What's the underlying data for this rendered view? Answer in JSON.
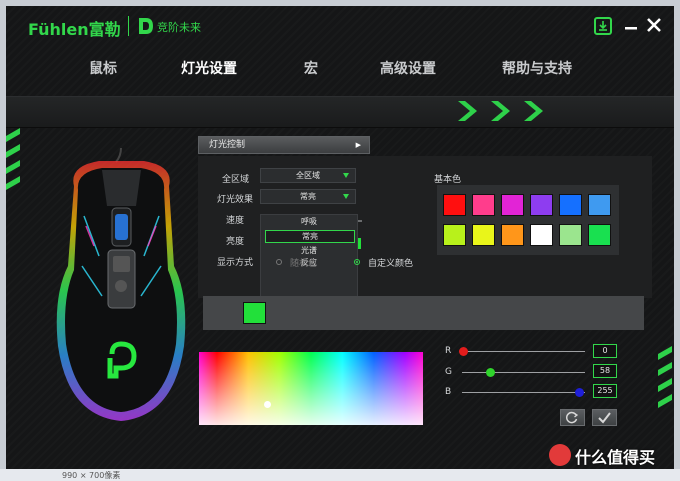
{
  "app": {
    "brand": "Fühlen富勒",
    "slogan": "竞阶未来"
  },
  "window_buttons": {
    "home_icon": "download-home-icon",
    "minimize_icon": "minimize-icon",
    "close_icon": "close-icon"
  },
  "nav": {
    "items": [
      {
        "label": "鼠标"
      },
      {
        "label": "灯光设置",
        "active": true
      },
      {
        "label": "宏"
      },
      {
        "label": "高级设置"
      },
      {
        "label": "帮助与支持"
      }
    ]
  },
  "lighting": {
    "section_title": "灯光控制",
    "zone_label": "全区域",
    "zone_value": "全区域",
    "effect_label": "灯光效果",
    "effect_value": "常亮",
    "speed_label": "速度",
    "brightness_label": "亮度",
    "display_label": "显示方式",
    "speed_level": 0.6,
    "effect_options": [
      "呼吸",
      "常亮",
      "光谱",
      "反应"
    ],
    "effect_selected": "常亮",
    "display_options": [
      "随机色",
      "自定义颜色"
    ],
    "display_selected": "自定义颜色"
  },
  "basic_colors": {
    "title": "基本色",
    "swatches": [
      "#ff0f0f",
      "#ff3d8c",
      "#e224d6",
      "#8e3df0",
      "#1570ff",
      "#3f9af0",
      "#b8f11b",
      "#e9f51a",
      "#ff961a",
      "#ffffff",
      "#9be58e",
      "#19e050"
    ]
  },
  "current_color": "#22e03a",
  "rgb": {
    "r_label": "R",
    "r": "0",
    "g_label": "G",
    "g": "58",
    "b_label": "B",
    "b": "255",
    "r_color": "#e31c1c",
    "g_color": "#30d42c",
    "b_color": "#1f1fd8"
  },
  "actions": {
    "reset_icon": "refresh-icon",
    "confirm_icon": "checkmark-icon"
  },
  "statusbar": {
    "dimensions": "990 × 700像素"
  },
  "watermark": {
    "text": "什么值得买"
  },
  "accent": "#32d74b"
}
